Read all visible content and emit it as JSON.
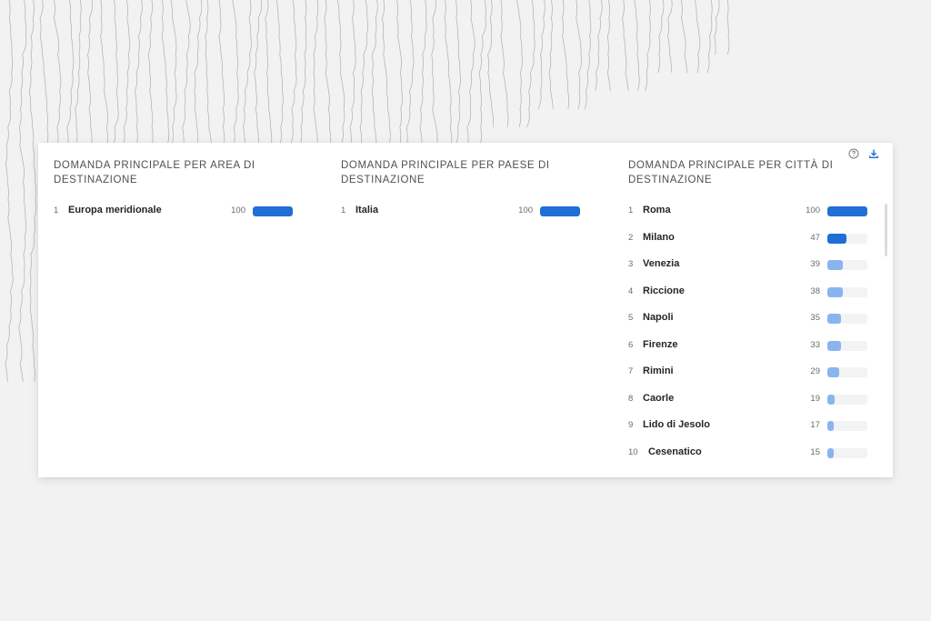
{
  "colors": {
    "bar_primary": "#1f6fd6",
    "bar_secondary": "#8ab4ef",
    "bar_track": "#f1f3f4",
    "background": "#f2f2f2"
  },
  "toolbar": {
    "help_icon": "help-circle-icon",
    "download_icon": "download-icon"
  },
  "panels": [
    {
      "title": "DOMANDA PRINCIPALE PER AREA DI DESTINAZIONE",
      "rows": [
        {
          "rank": "1",
          "name": "Europa meridionale",
          "value": 100
        }
      ]
    },
    {
      "title": "DOMANDA PRINCIPALE PER PAESE DI DESTINAZIONE",
      "rows": [
        {
          "rank": "1",
          "name": "Italia",
          "value": 100
        }
      ]
    },
    {
      "title": "DOMANDA PRINCIPALE PER CITTÀ DI DESTINAZIONE",
      "rows": [
        {
          "rank": "1",
          "name": "Roma",
          "value": 100
        },
        {
          "rank": "2",
          "name": "Milano",
          "value": 47
        },
        {
          "rank": "3",
          "name": "Venezia",
          "value": 39
        },
        {
          "rank": "4",
          "name": "Riccione",
          "value": 38
        },
        {
          "rank": "5",
          "name": "Napoli",
          "value": 35
        },
        {
          "rank": "6",
          "name": "Firenze",
          "value": 33
        },
        {
          "rank": "7",
          "name": "Rimini",
          "value": 29
        },
        {
          "rank": "8",
          "name": "Caorle",
          "value": 19
        },
        {
          "rank": "9",
          "name": "Lido di Jesolo",
          "value": 17
        },
        {
          "rank": "10",
          "name": "Cesenatico",
          "value": 15
        }
      ]
    }
  ]
}
